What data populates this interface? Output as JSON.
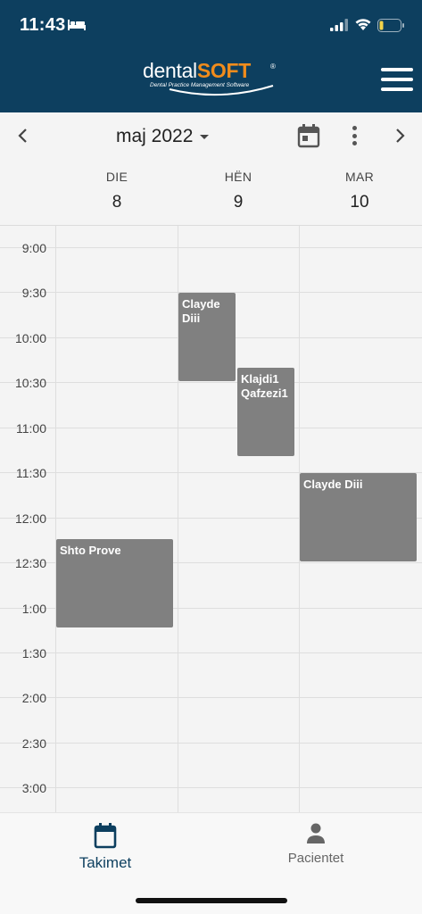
{
  "status_bar": {
    "time": "11:43"
  },
  "app": {
    "logo_main": "dental",
    "logo_accent": "SOFT",
    "logo_reg": "®",
    "logo_sub": "Dental Practice Management Software"
  },
  "toolbar": {
    "month": "maj 2022"
  },
  "days": [
    {
      "name": "DIE",
      "number": "8"
    },
    {
      "name": "HËN",
      "number": "9"
    },
    {
      "name": "MAR",
      "number": "10"
    }
  ],
  "times": [
    "9:00",
    "9:30",
    "10:00",
    "10:30",
    "11:00",
    "11:30",
    "12:00",
    "12:30",
    "1:00",
    "1:30",
    "2:00",
    "2:30",
    "3:00"
  ],
  "events": [
    {
      "title": "Clayde",
      "subtitle": "Diii"
    },
    {
      "title": "Klajdi1",
      "subtitle": "Qafzezi1"
    },
    {
      "title": "Clayde Diii",
      "subtitle": ""
    },
    {
      "title": "Shto Prove",
      "subtitle": ""
    }
  ],
  "bottom_nav": {
    "appointments": "Takimet",
    "patients": "Pacientet"
  },
  "colors": {
    "header": "#0d3f5f",
    "accent": "#f08c1c",
    "event": "#808080",
    "active_tab": "#0d3f5f"
  }
}
